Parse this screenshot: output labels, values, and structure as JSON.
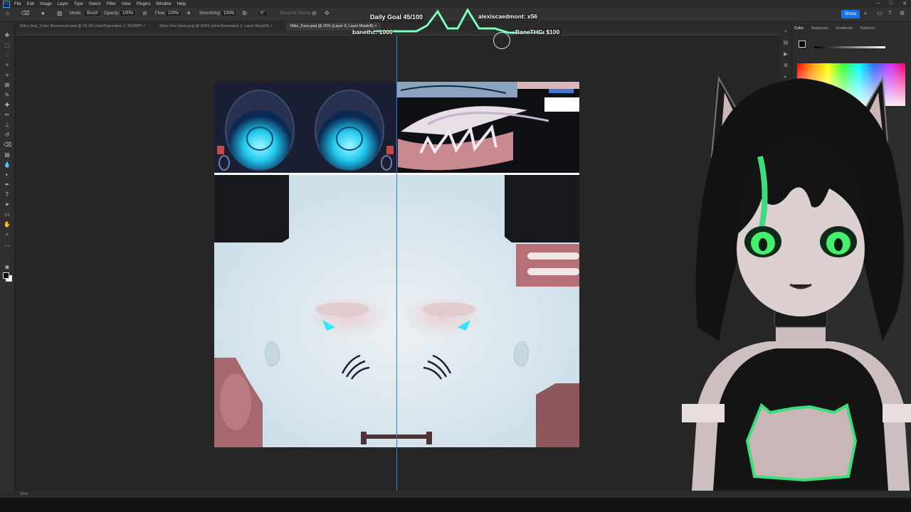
{
  "menubar": {
    "items": [
      "File",
      "Edit",
      "Image",
      "Layer",
      "Type",
      "Select",
      "Filter",
      "View",
      "Plugins",
      "Window",
      "Help"
    ]
  },
  "options": {
    "mode_label": "Mode:",
    "mode_value": "Brush",
    "opacity_label": "Opacity:",
    "opacity_value": "100%",
    "flow_label": "Flow:",
    "flow_value": "100%",
    "smoothing_label": "Smoothing:",
    "smoothing_value": "100%",
    "angle_value": "0°",
    "erase_history": "Erase to History",
    "share_label": "Share"
  },
  "tabs": [
    {
      "label": "Miko_Hair_Color Recovered.psd @ 33.3% (Hair/Saturation 1, RGB/8*) ×"
    },
    {
      "label": "Shiro Fox Hood.png @ 324% (Hue/Saturation 1, Layer Mask/8) ×"
    },
    {
      "label": "Miko_Face.psd @ 25% (Layer 9, Layer Mask/8) ×"
    }
  ],
  "overlay": {
    "daily_goal": "Daily Goal 45/100",
    "top_supporter": "alexiscaedmont: x56",
    "banethc_left": "banethc: 1000",
    "banethc_right": "BaneTHC: $100"
  },
  "color_panel": {
    "tabs": [
      "Color",
      "Swatches",
      "Gradients",
      "Patterns"
    ]
  },
  "status": {
    "text": "25%"
  },
  "colors": {
    "accent_blue": "#1473e6",
    "guide_line": "#3b7bd8",
    "goal_line": "#4cff9a",
    "eye_glow": "#2ee6ff"
  }
}
